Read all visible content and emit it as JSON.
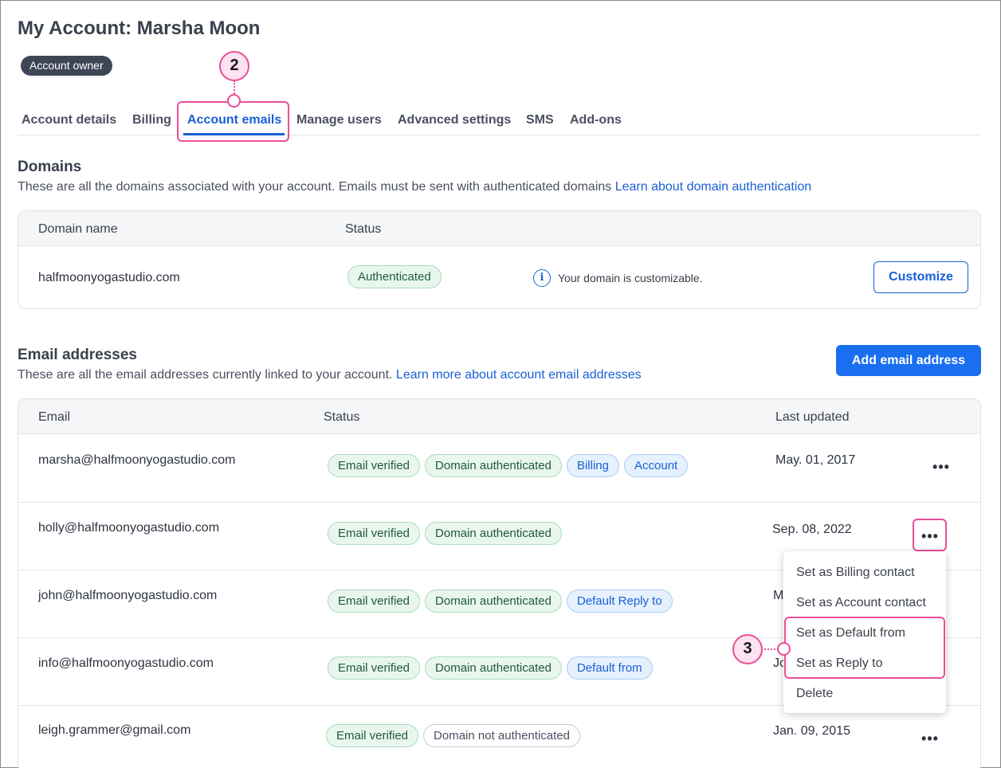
{
  "page": {
    "title": "My Account: Marsha Moon",
    "owner_badge": "Account owner"
  },
  "tabs": [
    {
      "label": "Account details",
      "active": false
    },
    {
      "label": "Billing",
      "active": false
    },
    {
      "label": "Account emails",
      "active": true
    },
    {
      "label": "Manage users",
      "active": false
    },
    {
      "label": "Advanced settings",
      "active": false
    },
    {
      "label": "SMS",
      "active": false
    },
    {
      "label": "Add-ons",
      "active": false
    }
  ],
  "callouts": {
    "tab_step": "2",
    "menu_step": "3"
  },
  "domains": {
    "title": "Domains",
    "description": "These are all the domains associated with your account. Emails must be sent with authenticated domains",
    "link": "Learn about domain authentication",
    "columns": [
      "Domain name",
      "Status"
    ],
    "rows": [
      {
        "domain": "halfmoonyogastudio.com",
        "status": "Authenticated",
        "info_text": "Your domain is customizable.",
        "action": "Customize"
      }
    ]
  },
  "emails": {
    "title": "Email addresses",
    "description": "These are all the email addresses currently linked to your account.",
    "link": "Learn more about account email addresses",
    "add_button": "Add email address",
    "columns": [
      "Email",
      "Status",
      "Last updated"
    ],
    "rows": [
      {
        "email": "marsha@halfmoonyogastudio.com",
        "tags": [
          {
            "label": "Email verified",
            "style": "green"
          },
          {
            "label": "Domain authenticated",
            "style": "green"
          },
          {
            "label": "Billing",
            "style": "blue"
          },
          {
            "label": "Account",
            "style": "blue"
          }
        ],
        "updated": "May. 01, 2017"
      },
      {
        "email": "holly@halfmoonyogastudio.com",
        "tags": [
          {
            "label": "Email verified",
            "style": "green"
          },
          {
            "label": "Domain authenticated",
            "style": "green"
          }
        ],
        "updated": "Sep. 08, 2022"
      },
      {
        "email": "john@halfmoonyogastudio.com",
        "tags": [
          {
            "label": "Email verified",
            "style": "green"
          },
          {
            "label": "Domain authenticated",
            "style": "green"
          },
          {
            "label": "Default Reply to",
            "style": "blue"
          }
        ],
        "updated": "M"
      },
      {
        "email": "info@halfmoonyogastudio.com",
        "tags": [
          {
            "label": "Email verified",
            "style": "green"
          },
          {
            "label": "Domain authenticated",
            "style": "green"
          },
          {
            "label": "Default from",
            "style": "blue"
          }
        ],
        "updated": "Jo"
      },
      {
        "email": "leigh.grammer@gmail.com",
        "tags": [
          {
            "label": "Email verified",
            "style": "green"
          },
          {
            "label": "Domain not authenticated",
            "style": "grey"
          }
        ],
        "updated": "Jan. 09, 2015"
      }
    ],
    "more_label": "•••"
  },
  "menu": {
    "items": [
      "Set as Billing contact",
      "Set as Account contact",
      "Set as Default from",
      "Set as Reply to",
      "Delete"
    ]
  }
}
